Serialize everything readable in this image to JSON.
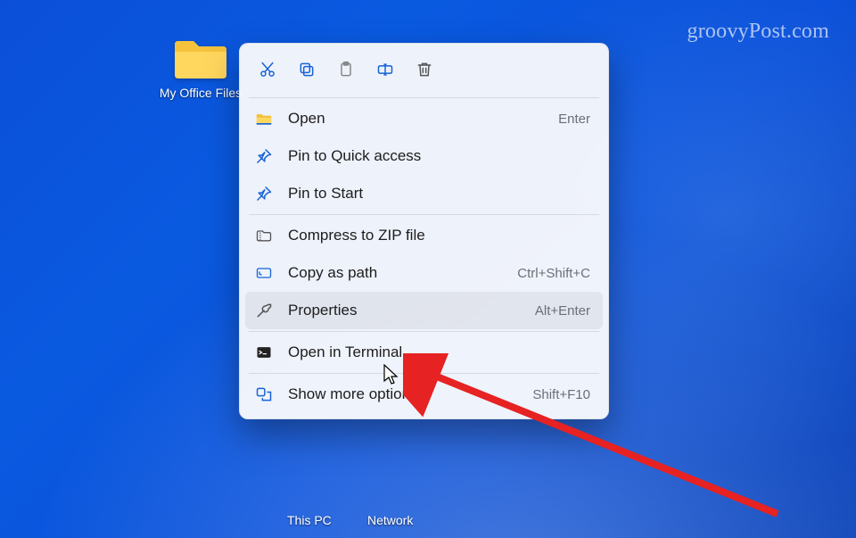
{
  "watermark": "groovyPost.com",
  "desktop": {
    "folder_label": "My Office Files",
    "labels": {
      "this_pc": "This PC",
      "network": "Network"
    }
  },
  "context_menu": {
    "toolbar": {
      "cut": "Cut",
      "copy": "Copy",
      "paste": "Paste",
      "rename": "Rename",
      "delete": "Delete"
    },
    "open": {
      "label": "Open",
      "shortcut": "Enter"
    },
    "pin_quick": {
      "label": "Pin to Quick access"
    },
    "pin_start": {
      "label": "Pin to Start"
    },
    "compress": {
      "label": "Compress to ZIP file"
    },
    "copy_path": {
      "label": "Copy as path",
      "shortcut": "Ctrl+Shift+C"
    },
    "properties": {
      "label": "Properties",
      "shortcut": "Alt+Enter"
    },
    "terminal": {
      "label": "Open in Terminal"
    },
    "more": {
      "label": "Show more options",
      "shortcut": "Shift+F10"
    }
  }
}
